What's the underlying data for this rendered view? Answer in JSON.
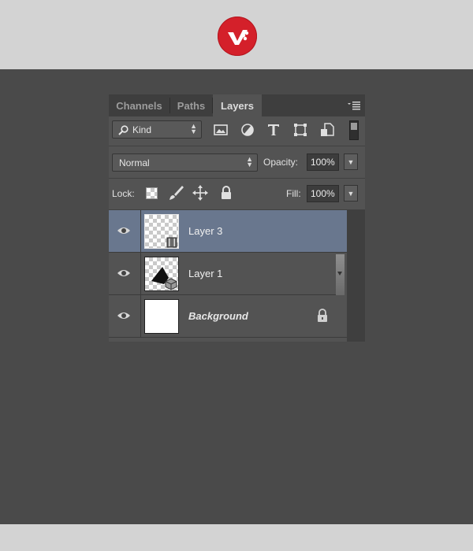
{
  "tabs": [
    {
      "label": "Channels",
      "active": false
    },
    {
      "label": "Paths",
      "active": false
    },
    {
      "label": "Layers",
      "active": true
    }
  ],
  "filter": {
    "kind_label": "Kind",
    "icons": [
      "image-filter-icon",
      "adjustment-filter-icon",
      "type-filter-icon",
      "shape-filter-icon",
      "smart-object-filter-icon",
      "filter-toggle-icon"
    ]
  },
  "blend": {
    "mode": "Normal",
    "opacity_label": "Opacity:",
    "opacity_value": "100%"
  },
  "lock": {
    "label": "Lock:",
    "icons": [
      "lock-transparent-pixels-icon",
      "lock-image-pixels-icon",
      "lock-position-icon",
      "lock-all-icon"
    ],
    "fill_label": "Fill:",
    "fill_value": "100%"
  },
  "layers": [
    {
      "name": "Layer 3",
      "selected": true,
      "visible": true,
      "thumbnail": "transparent-with-video-badge"
    },
    {
      "name": "Layer 1",
      "selected": false,
      "visible": true,
      "thumbnail": "shape-with-3d-badge"
    },
    {
      "name": "Background",
      "selected": false,
      "visible": true,
      "locked": true,
      "thumbnail": "white"
    }
  ],
  "colors": {
    "brand_red": "#d4202a",
    "selection": "#69778e",
    "panel_bg": "#535353"
  }
}
